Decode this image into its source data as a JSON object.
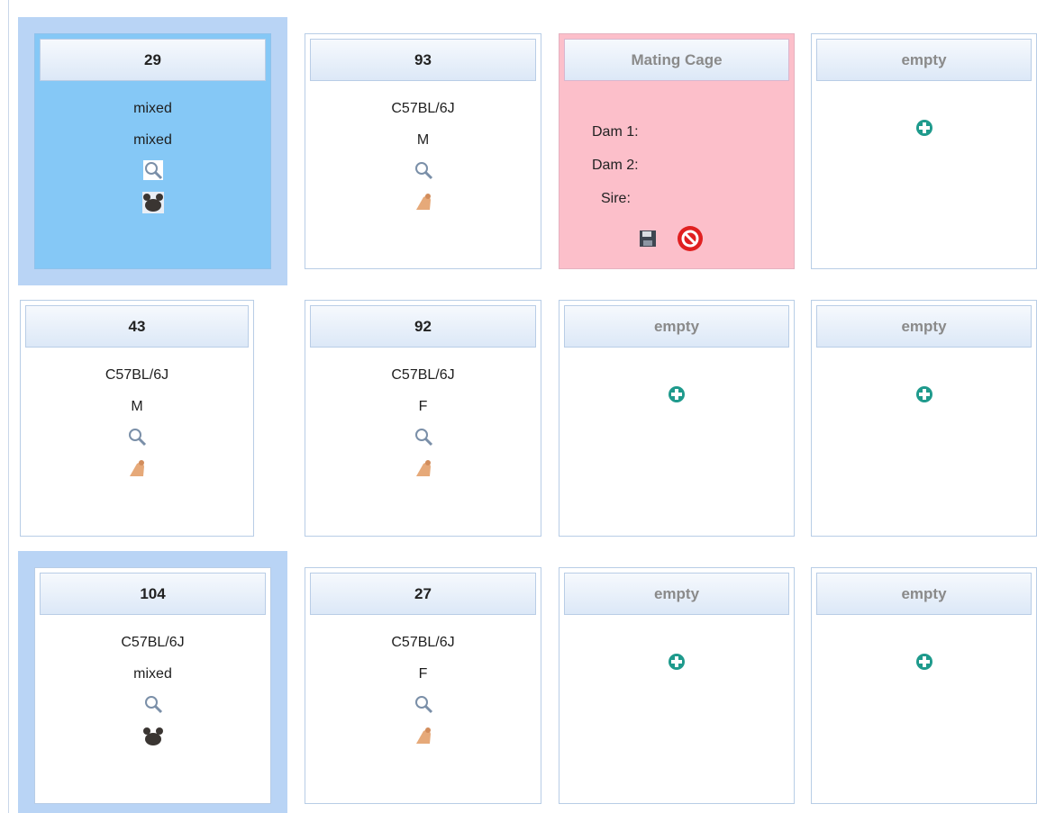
{
  "cages": [
    {
      "id": "r1c1",
      "type": "occupied",
      "selected": true,
      "number": "29",
      "strain": "mixed",
      "sex": "mixed",
      "mouse_icon": "dark-mouse-icon"
    },
    {
      "id": "r1c2",
      "type": "occupied",
      "selected": false,
      "number": "93",
      "strain": "C57BL/6J",
      "sex": "M",
      "mouse_icon": "tan-mouse-icon"
    },
    {
      "id": "r1c3",
      "type": "mating",
      "title": "Mating Cage",
      "dam1": "Dam 1:",
      "dam2": "Dam 2:",
      "sire": "Sire:"
    },
    {
      "id": "r1c4",
      "type": "empty",
      "title": "empty"
    },
    {
      "id": "r2c1",
      "type": "occupied",
      "selected": false,
      "number": "43",
      "strain": "C57BL/6J",
      "sex": "M",
      "mouse_icon": "tan-mouse-icon"
    },
    {
      "id": "r2c2",
      "type": "occupied",
      "selected": false,
      "number": "92",
      "strain": "C57BL/6J",
      "sex": "F",
      "mouse_icon": "tan-mouse-icon"
    },
    {
      "id": "r2c3",
      "type": "empty",
      "title": "empty"
    },
    {
      "id": "r2c4",
      "type": "empty",
      "title": "empty"
    },
    {
      "id": "r3c1",
      "type": "occupied",
      "selected": true,
      "number": "104",
      "strain": "C57BL/6J",
      "sex": "mixed",
      "mouse_icon": "dark-mouse-icon"
    },
    {
      "id": "r3c2",
      "type": "occupied",
      "selected": false,
      "number": "27",
      "strain": "C57BL/6J",
      "sex": "F",
      "mouse_icon": "tan-mouse-icon"
    },
    {
      "id": "r3c3",
      "type": "empty",
      "title": "empty"
    },
    {
      "id": "r3c4",
      "type": "empty",
      "title": "empty"
    }
  ],
  "colors": {
    "selected_cage": "#85c8f6",
    "selection_highlight": "#b9d4f5",
    "mating_cage": "#fcbfca",
    "add_icon": "#1e9a8c",
    "cancel_icon": "#e02020"
  }
}
